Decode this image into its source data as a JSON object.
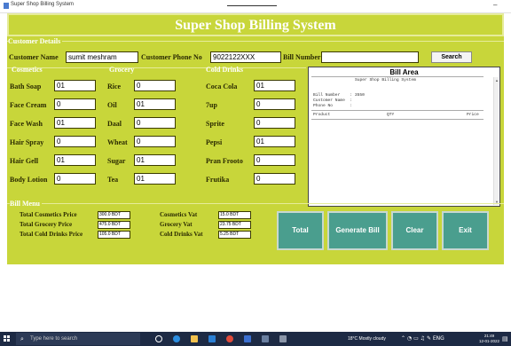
{
  "window": {
    "title": "Super Shop Billing System",
    "minimize_icon": "minimize-icon"
  },
  "app": {
    "header_title": "Super Shop Billing System",
    "colors": {
      "background": "#c8d63a",
      "section_text": "#ffffff",
      "button": "#4a9e8e"
    }
  },
  "customer": {
    "section_label": "Customer Details",
    "name_label": "Customer Name",
    "name_value": "sumit meshram",
    "phone_label": "Customer Phone No",
    "phone_value": "9022122XXX",
    "bill_label": "Bill Number",
    "bill_value": "",
    "search_label": "Search"
  },
  "cosmetics": {
    "label": "Cosmetics",
    "items": [
      {
        "name": "Bath Soap",
        "qty": "01"
      },
      {
        "name": "Face Cream",
        "qty": "0"
      },
      {
        "name": "Face Wash",
        "qty": "01"
      },
      {
        "name": "Hair Spray",
        "qty": "0"
      },
      {
        "name": "Hair Gell",
        "qty": "01"
      },
      {
        "name": "Body Lotion",
        "qty": "0"
      }
    ]
  },
  "grocery": {
    "label": "Grocery",
    "items": [
      {
        "name": "Rice",
        "qty": "0"
      },
      {
        "name": "Oil",
        "qty": "01"
      },
      {
        "name": "Daal",
        "qty": "0"
      },
      {
        "name": "Wheat",
        "qty": "0"
      },
      {
        "name": "Sugar",
        "qty": "01"
      },
      {
        "name": "Tea",
        "qty": "01"
      }
    ]
  },
  "cold_drinks": {
    "label": "Cold Drinks",
    "items": [
      {
        "name": "Coca Cola",
        "qty": "01"
      },
      {
        "name": "7up",
        "qty": "0"
      },
      {
        "name": "Sprite",
        "qty": "0"
      },
      {
        "name": "Pepsi",
        "qty": "01"
      },
      {
        "name": "Pran Frooto",
        "qty": "0"
      },
      {
        "name": "Frutika",
        "qty": "0"
      }
    ]
  },
  "bill_area": {
    "title": "Bill Area",
    "system_name": "Super Shop Billing System",
    "bill_number_line": "Bill Number    : 3550",
    "customer_name_line": "Customer Name  :",
    "phone_line": "Phone No       :",
    "columns": [
      "Product",
      "QTY",
      "Price"
    ]
  },
  "bill_menu": {
    "label": "Bill Menu",
    "total_cosmetics_label": "Total Cosmetics Price",
    "total_cosmetics_value": "300.0  BDT",
    "total_grocery_label": "Total Grocery Price",
    "total_grocery_value": "475.0  BDT",
    "total_cold_label": "Total Cold Drinks Price",
    "total_cold_value": "105.0  BDT",
    "cosmetics_vat_label": "Cosmetics Vat",
    "cosmetics_vat_value": "15.0  BDT",
    "grocery_vat_label": "Grocery Vat",
    "grocery_vat_value": "23.75  BDT",
    "cold_vat_label": "Cold Drinks Vat",
    "cold_vat_value": "5.25  BDT"
  },
  "buttons": {
    "total": "Total",
    "generate": "Generate Bill",
    "clear": "Clear",
    "exit": "Exit"
  },
  "taskbar": {
    "search_placeholder": "Type here to search",
    "weather": "18°C  Mostly cloudy",
    "time": "21:49",
    "date": "12-01-2022",
    "icons": [
      "windows-start-icon",
      "search-icon",
      "task-view-icon",
      "edge-icon",
      "file-explorer-icon",
      "vscode-icon",
      "chrome-icon",
      "store-icon",
      "python-icon",
      "app-icon"
    ]
  }
}
